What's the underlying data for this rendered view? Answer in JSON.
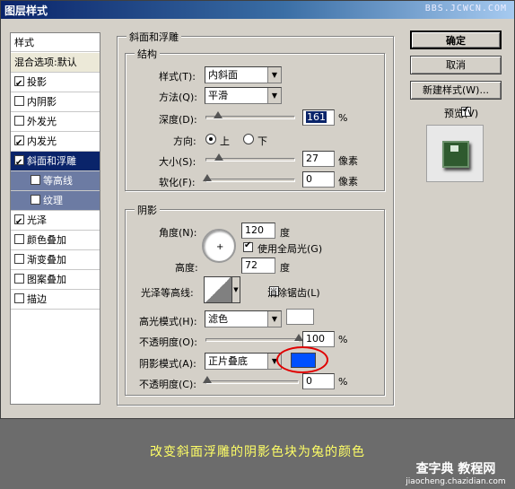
{
  "window": {
    "title": "图层样式",
    "watermark": "BBS.JCWCN.COM"
  },
  "styles_panel": {
    "header": "样式",
    "items": [
      {
        "label": "混合选项:默认",
        "checkbox": false,
        "checked": false
      },
      {
        "label": "投影",
        "checkbox": true,
        "checked": true
      },
      {
        "label": "内阴影",
        "checkbox": true,
        "checked": false
      },
      {
        "label": "外发光",
        "checkbox": true,
        "checked": false
      },
      {
        "label": "内发光",
        "checkbox": true,
        "checked": true
      },
      {
        "label": "斜面和浮雕",
        "checkbox": true,
        "checked": true,
        "selected": true
      },
      {
        "label": "等高线",
        "checkbox": true,
        "checked": false,
        "sub": true
      },
      {
        "label": "纹理",
        "checkbox": true,
        "checked": false,
        "sub": true
      },
      {
        "label": "光泽",
        "checkbox": true,
        "checked": true
      },
      {
        "label": "颜色叠加",
        "checkbox": true,
        "checked": false
      },
      {
        "label": "渐变叠加",
        "checkbox": true,
        "checked": false
      },
      {
        "label": "图案叠加",
        "checkbox": true,
        "checked": false
      },
      {
        "label": "描边",
        "checkbox": true,
        "checked": false
      }
    ]
  },
  "bevel": {
    "title": "斜面和浮雕",
    "structure": {
      "title": "结构",
      "style_label": "样式(T):",
      "style_value": "内斜面",
      "technique_label": "方法(Q):",
      "technique_value": "平滑",
      "depth_label": "深度(D):",
      "depth_value": "161",
      "depth_unit": "%",
      "depth_fraction": 0.08,
      "direction_label": "方向:",
      "dir_up": "上",
      "dir_down": "下",
      "size_label": "大小(S):",
      "size_value": "27",
      "size_unit": "像素",
      "size_fraction": 0.11,
      "soften_label": "软化(F):",
      "soften_value": "0",
      "soften_unit": "像素",
      "soften_fraction": 0.0
    },
    "shading": {
      "title": "阴影",
      "angle_label": "角度(N):",
      "angle_value": "120",
      "angle_unit": "度",
      "global_light_label": "使用全局光(G)",
      "altitude_label": "高度:",
      "altitude_value": "72",
      "altitude_unit": "度",
      "gloss_label": "光泽等高线:",
      "antialias_label": "消除锯齿(L)",
      "highlight_mode_label": "高光模式(H):",
      "highlight_mode_value": "滤色",
      "highlight_color": "#ffffff",
      "highlight_opacity_label": "不透明度(O):",
      "highlight_opacity_value": "100",
      "highlight_opacity_unit": "%",
      "highlight_opacity_fraction": 1.0,
      "shadow_mode_label": "阴影模式(A):",
      "shadow_mode_value": "正片叠底",
      "shadow_color": "#0050ff",
      "shadow_opacity_label": "不透明度(C):",
      "shadow_opacity_value": "0",
      "shadow_opacity_unit": "%",
      "shadow_opacity_fraction": 0.0
    }
  },
  "buttons": {
    "ok": "确定",
    "cancel": "取消",
    "new_style": "新建样式(W)...",
    "preview": "预览(V)"
  },
  "caption": "改变斜面浮雕的阴影色块为兔的颜色",
  "watermark_bottom": {
    "line1": "查字典 教程网",
    "line2": "jiaocheng.chazidian.com"
  },
  "colors": {
    "accent": "#0a246a",
    "annotation_circle": "#e00000",
    "caption": "#ffff66"
  }
}
